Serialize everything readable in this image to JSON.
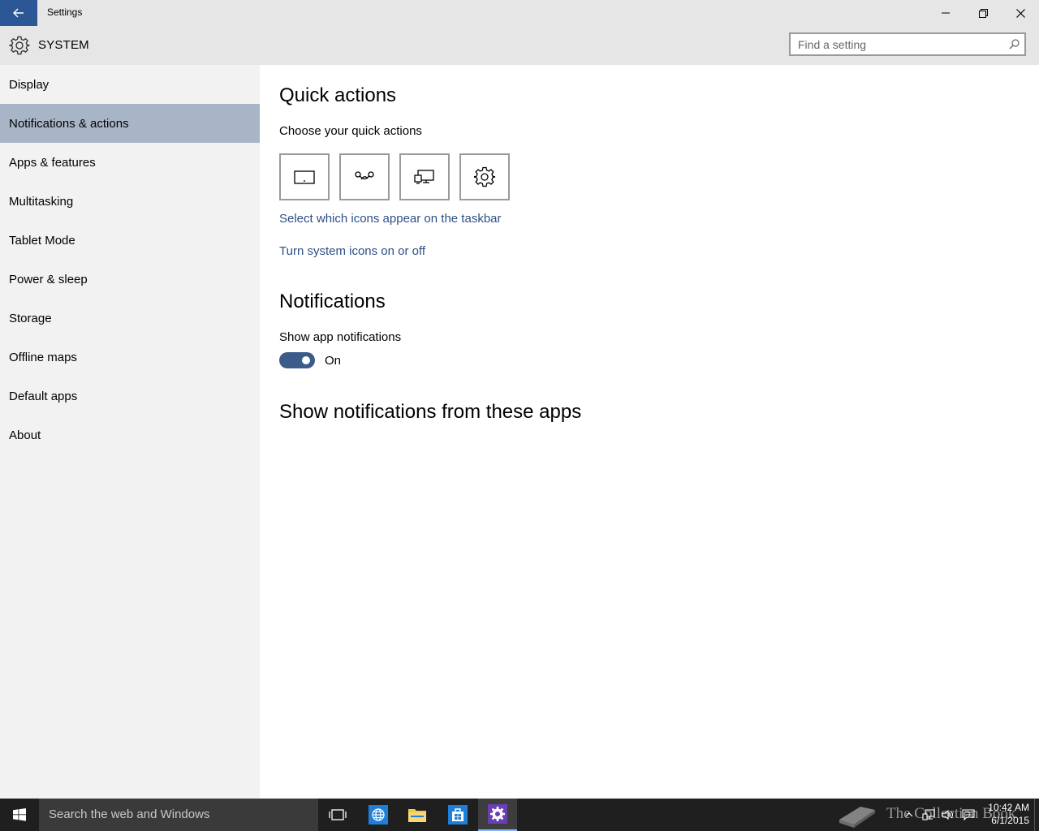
{
  "window": {
    "title": "Settings"
  },
  "header": {
    "section_title": "SYSTEM",
    "search_placeholder": "Find a setting"
  },
  "sidebar": {
    "items": [
      {
        "label": "Display",
        "selected": false
      },
      {
        "label": "Notifications & actions",
        "selected": true
      },
      {
        "label": "Apps & features",
        "selected": false
      },
      {
        "label": "Multitasking",
        "selected": false
      },
      {
        "label": "Tablet Mode",
        "selected": false
      },
      {
        "label": "Power & sleep",
        "selected": false
      },
      {
        "label": "Storage",
        "selected": false
      },
      {
        "label": "Offline maps",
        "selected": false
      },
      {
        "label": "Default apps",
        "selected": false
      },
      {
        "label": "About",
        "selected": false
      }
    ]
  },
  "main": {
    "quick_actions_heading": "Quick actions",
    "quick_actions_subtitle": "Choose your quick actions",
    "quick_action_icons": [
      "tablet-mode-icon",
      "connect-icon",
      "project-icon",
      "all-settings-icon"
    ],
    "link_taskbar_icons": "Select which icons appear on the taskbar",
    "link_system_icons": "Turn system icons on or off",
    "notifications_heading": "Notifications",
    "show_app_notifications_label": "Show app notifications",
    "toggle_state": "On",
    "apps_heading": "Show notifications from these apps"
  },
  "taskbar": {
    "search_placeholder": "Search the web and Windows",
    "watermark": "The Collection Book",
    "time": "10:42 AM",
    "date": "6/1/2015"
  },
  "colors": {
    "accent": "#2b5797",
    "selected_nav": "#a8b5c7",
    "link": "#2d4f86",
    "toggle_on": "#3c5a8a"
  }
}
